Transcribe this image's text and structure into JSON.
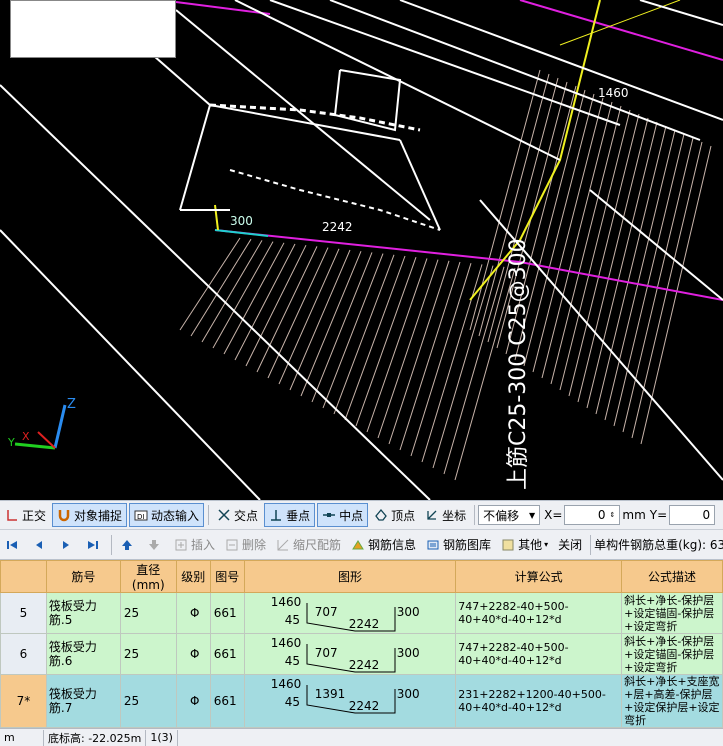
{
  "viewport": {
    "labels": {
      "dim_1460": "1460",
      "dim_300": "300",
      "dim_2242": "2242",
      "vertical_annotation": "上筋C25-300 C25@300"
    },
    "axes": {
      "z": "Z",
      "x": "X",
      "y": "Y"
    },
    "colors": {
      "magenta": "#e020e0",
      "yellow": "#f0f020",
      "cyan": "#20d0d0",
      "white": "#ffffff",
      "hatch": "#c8b4aa",
      "green": "#2aa02a"
    }
  },
  "toolbar1": {
    "ortho": "正交",
    "snap": "对象捕捉",
    "dynamic_input": "动态输入",
    "intersection": "交点",
    "perpendicular": "垂点",
    "midpoint": "中点",
    "vertex": "顶点",
    "coordinate": "坐标",
    "offset_value": "不偏移",
    "x_label": "X=",
    "x_value": "0",
    "mm_label": "mm",
    "y_label": "Y=",
    "y_value": "0"
  },
  "toolbar2": {
    "insert": "插入",
    "delete": "删除",
    "scale_rebar": "缩尺配筋",
    "rebar_info": "钢筋信息",
    "rebar_library": "钢筋图库",
    "other": "其他",
    "close": "关闭",
    "total_weight_label": "单构件钢筋总重(kg): 63"
  },
  "grid": {
    "columns": [
      "筋号",
      "直径(mm)",
      "级别",
      "图号",
      "图形",
      "计算公式",
      "公式描述"
    ],
    "rows": [
      {
        "index": "5",
        "name": "筏板受力筋.5",
        "diameter": "25",
        "grade": "Φ",
        "code": "661",
        "shape": {
          "top_left": "1460",
          "bottom_left": "45",
          "seg1": "707",
          "seg2": "2242",
          "right": "300"
        },
        "formula": "747+2282-40+500-40+40*d-40+12*d",
        "desc": "斜长+净长-保护层+设定锚固-保护层+设定弯折",
        "selected": false
      },
      {
        "index": "6",
        "name": "筏板受力筋.6",
        "diameter": "25",
        "grade": "Φ",
        "code": "661",
        "shape": {
          "top_left": "1460",
          "bottom_left": "45",
          "seg1": "707",
          "seg2": "2242",
          "right": "300"
        },
        "formula": "747+2282-40+500-40+40*d-40+12*d",
        "desc": "斜长+净长-保护层+设定锚固-保护层+设定弯折",
        "selected": false
      },
      {
        "index": "7*",
        "name": "筏板受力筋.7",
        "diameter": "25",
        "grade": "Φ",
        "code": "661",
        "shape": {
          "top_left": "1460",
          "bottom_left": "45",
          "seg1": "1391",
          "seg2": "2242",
          "right": "300"
        },
        "formula": "231+2282+1200-40+500-40+40*d-40+12*d",
        "desc": "斜长+净长+支座宽+层+高差-保护层+设定保护层+设定弯折",
        "selected": true
      },
      {
        "index": "8",
        "empty": true
      }
    ]
  },
  "status": {
    "unit": "m",
    "bottom_elevation": "底标高: -22.025m",
    "page": "1(3)"
  }
}
